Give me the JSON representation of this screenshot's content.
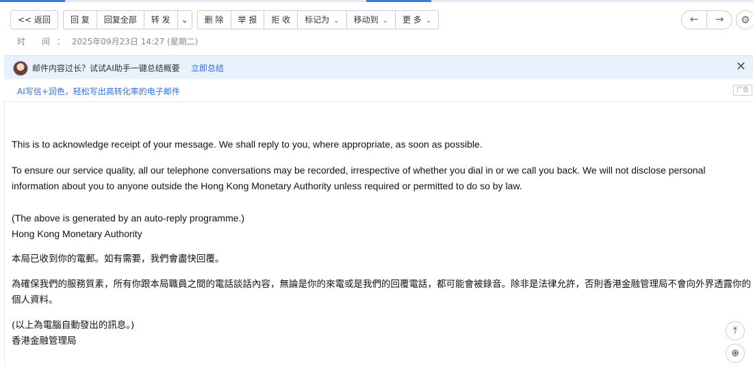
{
  "toolbar": {
    "back": "<< 返回",
    "reply": "回 复",
    "reply_all": "回复全部",
    "forward": "转 发",
    "delete": "删 除",
    "report": "举 报",
    "reject": "拒 收",
    "mark_as": "标记为",
    "move_to": "移动到",
    "more": "更 多",
    "caret": "⌄"
  },
  "nav": {
    "prev": "←",
    "next": "→",
    "settings": "⚙"
  },
  "time": {
    "label": "时 间：",
    "value": "2025年09月23日 14:27 (星期二)"
  },
  "ai_banner": {
    "text": "邮件内容过长？试试AI助手一键总结概要",
    "link": "立即总结",
    "close": "✕"
  },
  "promo": {
    "link": "AI写信+润色，轻松写出高转化率的电子邮件",
    "ad": "广告"
  },
  "message": {
    "p1": "This is to acknowledge receipt of your message.  We shall reply to you, where appropriate, as soon as possible.",
    "p2": "To ensure our service quality, all our telephone conversations may be recorded, irrespective of whether you dial in or we call you back. We will not disclose personal information about you to anyone outside the Hong Kong Monetary Authority unless required or permitted to do so by law.",
    "p3a": "(The above is generated by an auto-reply programme.)",
    "p3b": "Hong Kong Monetary Authority",
    "p4": "本局已收到你的電郵。如有需要，我們會盡快回覆。",
    "p5": "為確保我們的服務質素，所有你跟本局職員之間的電話談話內容，無論是你的來電或是我們的回覆電話，都可能會被錄音。除非是法律允許，否則香港金融管理局不會向外界透露你的個人資料。",
    "p6a": "(以上為電腦自動發出的訊息。)",
    "p6b": "香港金融管理局"
  },
  "floating": {
    "top": "⤒",
    "zoom": "⊕"
  }
}
